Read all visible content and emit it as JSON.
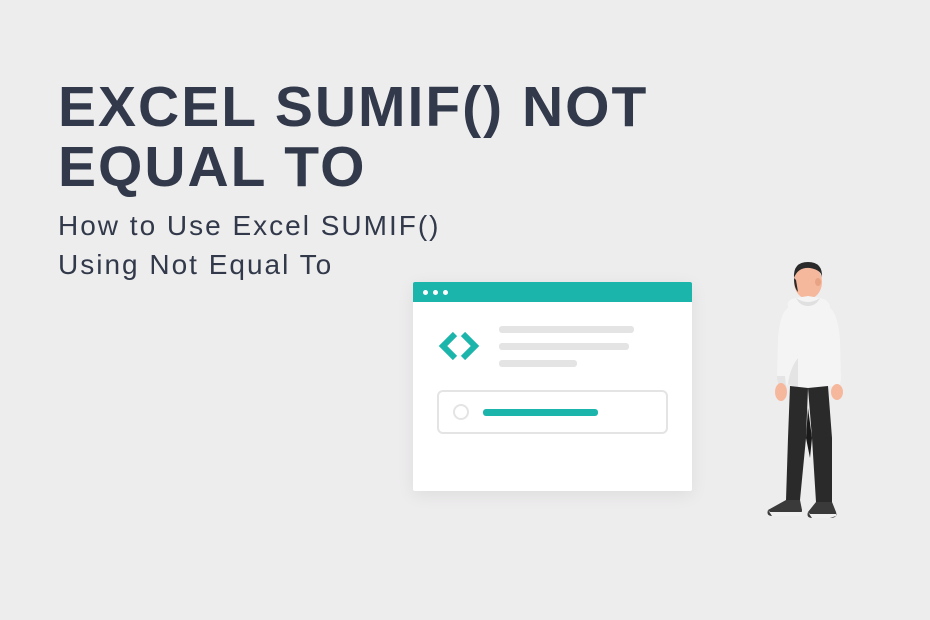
{
  "title": "EXCEL SUMIF() NOT EQUAL TO",
  "subtitle_line1": "How to Use Excel SUMIF()",
  "subtitle_line2": "Using Not Equal To",
  "colors": {
    "background": "#eeedee",
    "text": "#31394a",
    "accent": "#1cb5ac",
    "placeholder": "#e4e4e4"
  }
}
